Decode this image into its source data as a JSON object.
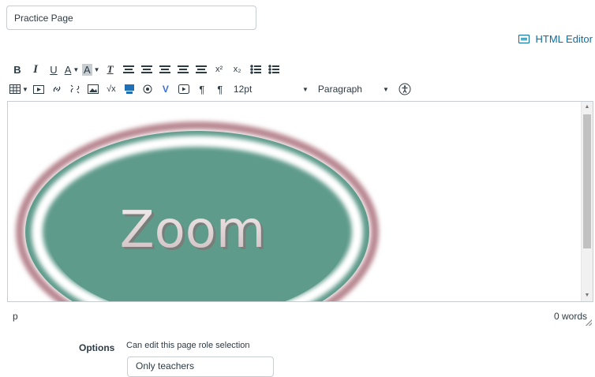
{
  "page_title": {
    "value": "Practice Page"
  },
  "header": {
    "html_editor_label": "HTML Editor"
  },
  "toolbar": {
    "row1": {
      "bold": "B",
      "italic": "I",
      "underline": "U",
      "text_color": "A",
      "background_color": "A",
      "clear_formatting": "T",
      "superscript": "x²",
      "subscript": "x₂"
    },
    "row2": {
      "rtl_mark": "¶",
      "ltr_mark": "¶",
      "font_size": "12pt",
      "block_format": "Paragraph"
    }
  },
  "editor": {
    "image_text": "Zoom",
    "image_colors": {
      "fill": "#5f9b8b",
      "ring": "#b88690",
      "text": "#e9e1e3"
    }
  },
  "status": {
    "path": "p",
    "word_count": "0 words"
  },
  "options": {
    "label": "Options",
    "description": "Can edit this page role selection",
    "selected": "Only teachers"
  },
  "colors": {
    "accent": "#0770a3",
    "text": "#2d3b45",
    "border": "#c7cdd1"
  }
}
